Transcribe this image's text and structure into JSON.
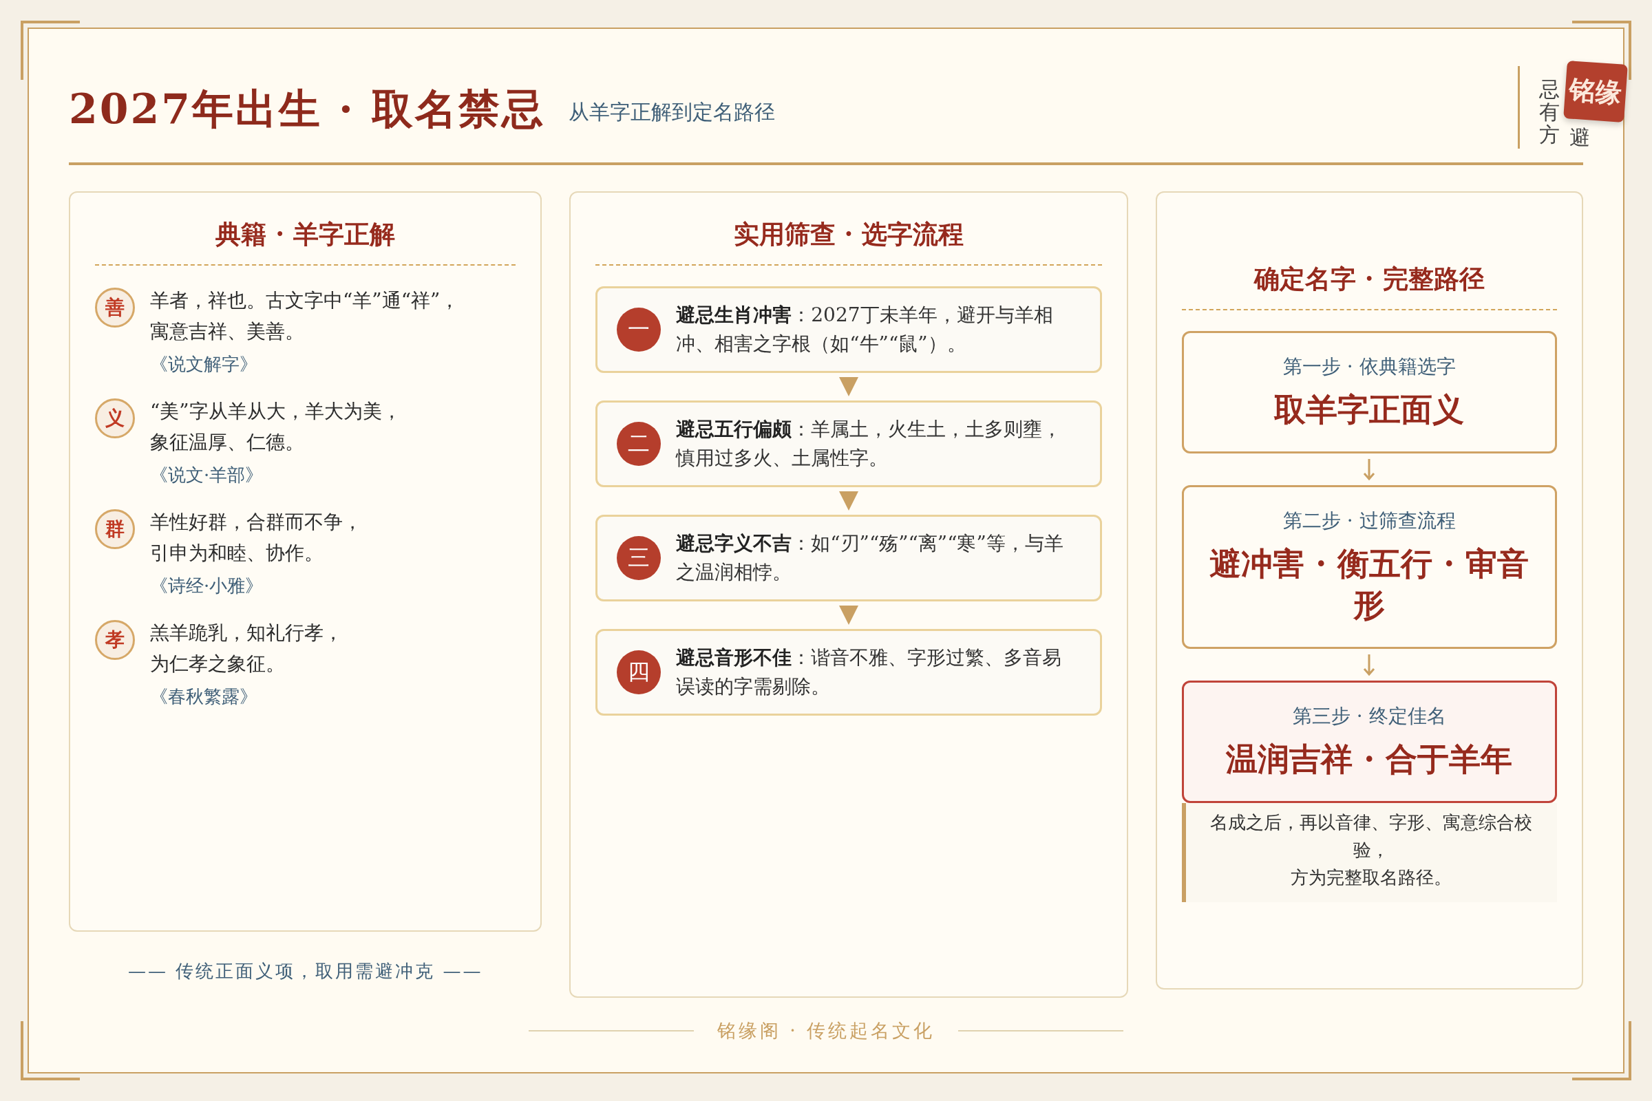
{
  "header": {
    "title": "2027年出生 · 取名禁忌",
    "subtitle": "从羊字正解到定名路径",
    "vertical_text": [
      "忌有方",
      "避"
    ],
    "seal": "铭缘"
  },
  "classics": {
    "title": "典籍 · 羊字正解",
    "entries": [
      {
        "badge": "善",
        "lines": [
          "羊者，祥也。古文字中“羊”通“祥”，",
          "寓意吉祥、美善。"
        ],
        "source": "《说文解字》"
      },
      {
        "badge": "义",
        "lines": [
          "“美”字从羊从大，羊大为美，",
          "象征温厚、仁德。"
        ],
        "source": "《说文·羊部》"
      },
      {
        "badge": "群",
        "lines": [
          "羊性好群，合群而不争，",
          "引申为和睦、协作。"
        ],
        "source": "《诗经·小雅》"
      },
      {
        "badge": "孝",
        "lines": [
          "羔羊跪乳，知礼行孝，",
          "为仁孝之象征。"
        ],
        "source": "《春秋繁露》"
      }
    ],
    "note": "—— 传统正面义项，取用需避冲克 ——"
  },
  "screening": {
    "title": "实用筛查 · 选字流程",
    "steps": [
      {
        "number": "一",
        "text": "**避忌生肖冲害**：2027丁未羊年，避开与羊相冲、相害之字根（如“牛”“鼠”）。"
      },
      {
        "number": "二",
        "text": "**避忌五行偏颇**：羊属土，火生土，土多则壅，慎用过多火、土属性字。"
      },
      {
        "number": "三",
        "text": "**避忌字义不吉**：如“刃”“殇”“离”“寒”等，与羊之温润相悖。"
      },
      {
        "number": "四",
        "text": "**避忌音形不佳**：谐音不雅、字形过繁、多音易误读的字需剔除。"
      }
    ]
  },
  "path": {
    "title": "确定名字 · 完整路径",
    "steps": [
      {
        "kind": "step",
        "label": "第一步 · 依典籍选字",
        "result": "取羊字正面义"
      },
      {
        "kind": "step",
        "label": "第二步 · 过筛查流程",
        "result": "避冲害 · 衡五行 · 审音形"
      },
      {
        "kind": "final",
        "label": "第三步 · 终定佳名",
        "result": "温润吉祥 · 合于羊年"
      }
    ],
    "note": [
      "名成之后，再以音律、字形、寓意综合校验，",
      "方为完整取名路径。"
    ]
  },
  "footer": "铭缘阁 · 传统起名文化"
}
